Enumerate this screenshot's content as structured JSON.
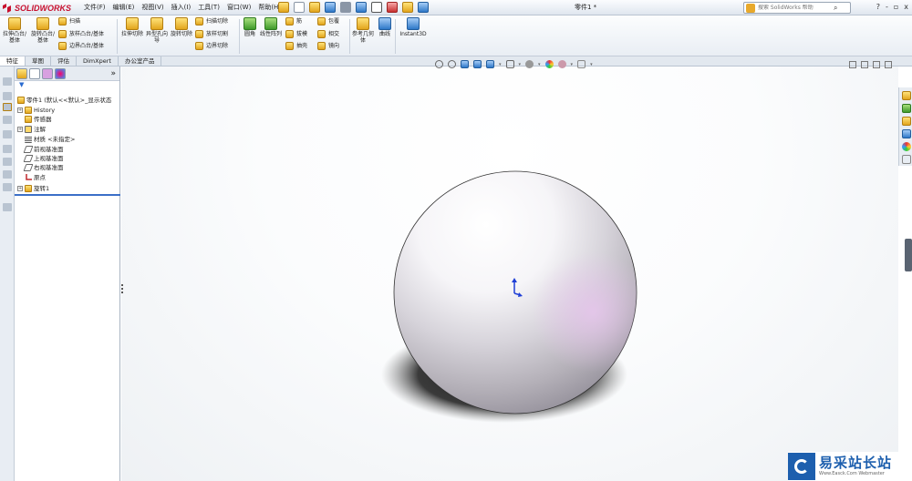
{
  "app": {
    "name": "SOLIDWORKS",
    "document_title": "零件1 *"
  },
  "menu": [
    "文件(F)",
    "编辑(E)",
    "视图(V)",
    "插入(I)",
    "工具(T)",
    "窗口(W)",
    "帮助(H)"
  ],
  "search": {
    "placeholder": "搜索 SolidWorks 帮助"
  },
  "window_buttons": [
    "?",
    "-",
    "▫",
    "x"
  ],
  "ribbon": {
    "big": [
      {
        "label": "拉伸凸台/基体",
        "icon": "extrude-boss-icon"
      },
      {
        "label": "旋转凸台/基体",
        "icon": "revolve-boss-icon"
      },
      {
        "label": "拉伸切除",
        "icon": "extrude-cut-icon"
      },
      {
        "label": "异型孔向导",
        "icon": "hole-wizard-icon"
      },
      {
        "label": "旋转切除",
        "icon": "revolve-cut-icon"
      },
      {
        "label": "线性阵列",
        "icon": "linear-pattern-icon"
      },
      {
        "label": "参考几何体",
        "icon": "reference-geometry-icon"
      },
      {
        "label": "曲线",
        "icon": "curves-icon"
      },
      {
        "label": "Instant3D",
        "icon": "instant3d-icon"
      }
    ],
    "small": [
      {
        "label": "扫描",
        "icon": "sweep-icon"
      },
      {
        "label": "放样凸台/基体",
        "icon": "loft-icon"
      },
      {
        "label": "边界凸台/基体",
        "icon": "boundary-boss-icon"
      },
      {
        "label": "扫描切除",
        "icon": "swept-cut-icon"
      },
      {
        "label": "放样切割",
        "icon": "lofted-cut-icon"
      },
      {
        "label": "边界切除",
        "icon": "boundary-cut-icon"
      },
      {
        "label": "圆角",
        "icon": "fillet-icon"
      },
      {
        "label": "筋",
        "icon": "rib-icon"
      },
      {
        "label": "拔模",
        "icon": "draft-icon"
      },
      {
        "label": "抽壳",
        "icon": "shell-icon"
      },
      {
        "label": "包覆",
        "icon": "wrap-icon"
      },
      {
        "label": "相交",
        "icon": "intersect-icon"
      },
      {
        "label": "镜向",
        "icon": "mirror-icon"
      }
    ]
  },
  "tabs": [
    "特征",
    "草图",
    "评估",
    "DimXpert",
    "办公室产品"
  ],
  "feature_tree": [
    {
      "label": "零件1 (默认<<默认>_显示状态",
      "icon": "part-icon",
      "expand": false
    },
    {
      "label": "History",
      "icon": "history-folder-icon",
      "expand": true
    },
    {
      "label": "传感器",
      "icon": "sensors-folder-icon",
      "expand": false
    },
    {
      "label": "注解",
      "icon": "annotations-icon",
      "expand": true
    },
    {
      "label": "材质 <未指定>",
      "icon": "material-icon",
      "expand": false
    },
    {
      "label": "前视基准面",
      "icon": "plane-icon",
      "expand": false
    },
    {
      "label": "上视基准面",
      "icon": "plane-icon",
      "expand": false
    },
    {
      "label": "右视基准面",
      "icon": "plane-icon",
      "expand": false
    },
    {
      "label": "原点",
      "icon": "origin-icon",
      "expand": false
    },
    {
      "label": "旋转1",
      "icon": "revolve-feature-icon",
      "expand": true
    }
  ],
  "fm_more": "»",
  "watermark": {
    "cn": "易采站长站",
    "en": "Www.Easck.Com Webmaster"
  }
}
